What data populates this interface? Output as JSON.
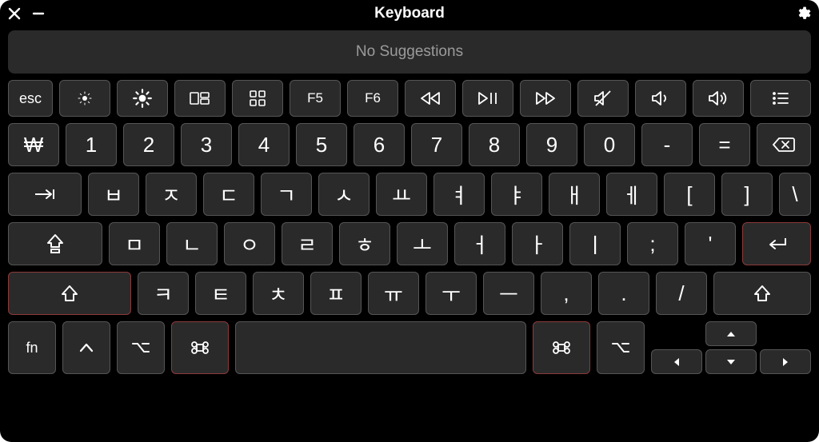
{
  "title": "Keyboard",
  "suggestions_text": "No Suggestions",
  "fn_row": {
    "esc": "esc",
    "f5": "F5",
    "f6": "F6"
  },
  "rows": {
    "num": [
      "₩",
      "1",
      "2",
      "3",
      "4",
      "5",
      "6",
      "7",
      "8",
      "9",
      "0",
      "-",
      "="
    ],
    "q": [
      "ㅂ",
      "ㅈ",
      "ㄷ",
      "ㄱ",
      "ㅅ",
      "ㅛ",
      "ㅕ",
      "ㅑ",
      "ㅐ",
      "ㅔ",
      "[",
      "]",
      "\\"
    ],
    "a": [
      "ㅁ",
      "ㄴ",
      "ㅇ",
      "ㄹ",
      "ㅎ",
      "ㅗ",
      "ㅓ",
      "ㅏ",
      "ㅣ",
      ";",
      "'"
    ],
    "z": [
      "ㅋ",
      "ㅌ",
      "ㅊ",
      "ㅍ",
      "ㅠ",
      "ㅜ",
      "ㅡ",
      ",",
      ".",
      "/"
    ]
  },
  "bottom": {
    "fn": "fn"
  },
  "icons": {
    "close": "close-icon",
    "minimize": "minimize-icon",
    "settings": "gear-icon",
    "brightness_down": "brightness-down-icon",
    "brightness_up": "brightness-up-icon",
    "mission_control": "mission-control-icon",
    "launchpad": "launchpad-icon",
    "rewind": "rewind-icon",
    "play_pause": "play-pause-icon",
    "fast_forward": "fast-forward-icon",
    "mute": "mute-icon",
    "volume_down": "volume-down-icon",
    "volume_up": "volume-up-icon",
    "menu": "menu-icon",
    "backspace": "backspace-icon",
    "tab": "tab-icon",
    "caps": "caps-lock-icon",
    "return": "return-icon",
    "shift": "shift-icon",
    "control": "control-icon",
    "option": "option-icon",
    "command": "command-icon",
    "up": "arrow-up-icon",
    "down": "arrow-down-icon",
    "left": "arrow-left-icon",
    "right": "arrow-right-icon"
  }
}
